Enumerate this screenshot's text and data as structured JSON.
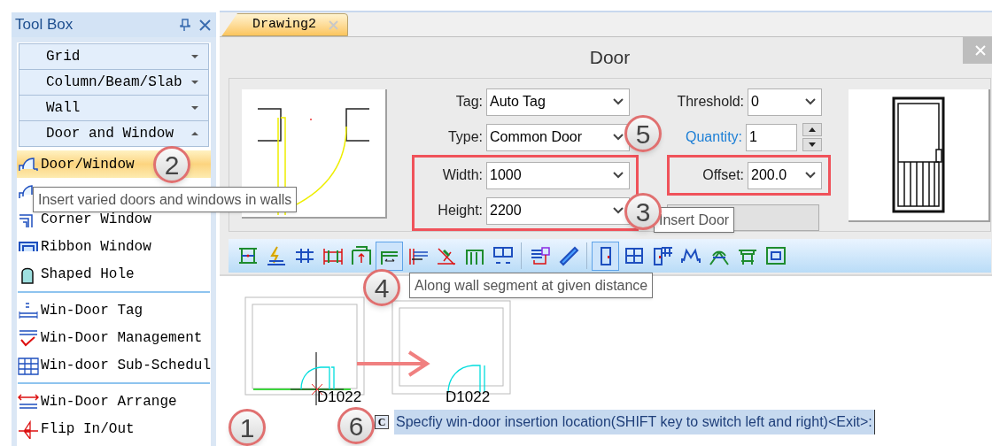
{
  "toolbox": {
    "title": "Tool Box",
    "categories": [
      {
        "label": "Grid",
        "expanded": false
      },
      {
        "label": "Column/Beam/Slab",
        "expanded": false
      },
      {
        "label": "Wall",
        "expanded": false
      },
      {
        "label": "Door and Window",
        "expanded": true
      }
    ],
    "items": [
      {
        "kind": "tool",
        "label": "Door/Window",
        "selected": true
      },
      {
        "kind": "tool",
        "selected": false
      },
      {
        "kind": "tool",
        "label": "Corner Window",
        "selected": false
      },
      {
        "kind": "tool",
        "label": "Ribbon Window",
        "selected": false
      },
      {
        "kind": "tool",
        "label": "Shaped Hole",
        "selected": false
      },
      {
        "kind": "divider"
      },
      {
        "kind": "tool",
        "label": "Win-Door Tag",
        "selected": false
      },
      {
        "kind": "tool",
        "label": "Win-Door Management",
        "selected": false
      },
      {
        "kind": "tool",
        "label": "Win-door Sub-Schedul",
        "selected": false
      },
      {
        "kind": "divider"
      },
      {
        "kind": "tool",
        "label": "Win-Door Arrange",
        "selected": false
      },
      {
        "kind": "tool",
        "label": "Flip In/Out",
        "selected": false
      }
    ]
  },
  "tab": {
    "label": "Drawing2",
    "selected": true
  },
  "dialog": {
    "title": "Door",
    "left_fields": [
      {
        "kind": "combo",
        "label": "Tag:",
        "value": "Auto Tag",
        "highlighted": false
      },
      {
        "kind": "combo",
        "label": "Type:",
        "value": "Common Door",
        "highlighted": false
      },
      {
        "kind": "combo",
        "label": "Width:",
        "value": "1000",
        "highlighted": true
      },
      {
        "kind": "combo",
        "label": "Height:",
        "value": "2200",
        "highlighted": true
      }
    ],
    "right_fields": [
      {
        "kind": "combo",
        "label": "Threshold:",
        "value": "0",
        "highlighted": false
      },
      {
        "kind": "spinner",
        "label": "Quantity:",
        "value": "1",
        "highlighted": false
      },
      {
        "kind": "combo",
        "label": "Offset:",
        "value": "200.0",
        "highlighted": true
      }
    ],
    "toolbar": [
      [
        {
          "selected": false
        },
        {
          "selected": false
        },
        {
          "selected": false
        },
        {
          "selected": false
        },
        {
          "selected": false
        },
        {
          "selected": true
        },
        {
          "selected": false
        },
        {
          "selected": false
        },
        {
          "selected": false
        },
        {
          "selected": false
        }
      ],
      [
        {
          "selected": false
        },
        {
          "selected": false
        }
      ],
      [
        {
          "selected": true
        },
        {
          "selected": false
        },
        {
          "selected": false
        },
        {
          "selected": false
        },
        {
          "selected": false
        },
        {
          "selected": false
        },
        {
          "selected": false
        }
      ]
    ]
  },
  "canvas": {
    "labels": [
      "D1022",
      "D1022"
    ],
    "command_icon": "C",
    "command": "Specfiy win-door insertion location(SHIFT key to switch left and right)<Exit>:"
  },
  "tooltips": [
    "Insert varied doors and windows in walls",
    "Insert Door",
    "Along wall segment at given distance"
  ],
  "callouts": [
    "1",
    "2",
    "3",
    "4",
    "5",
    "6"
  ]
}
